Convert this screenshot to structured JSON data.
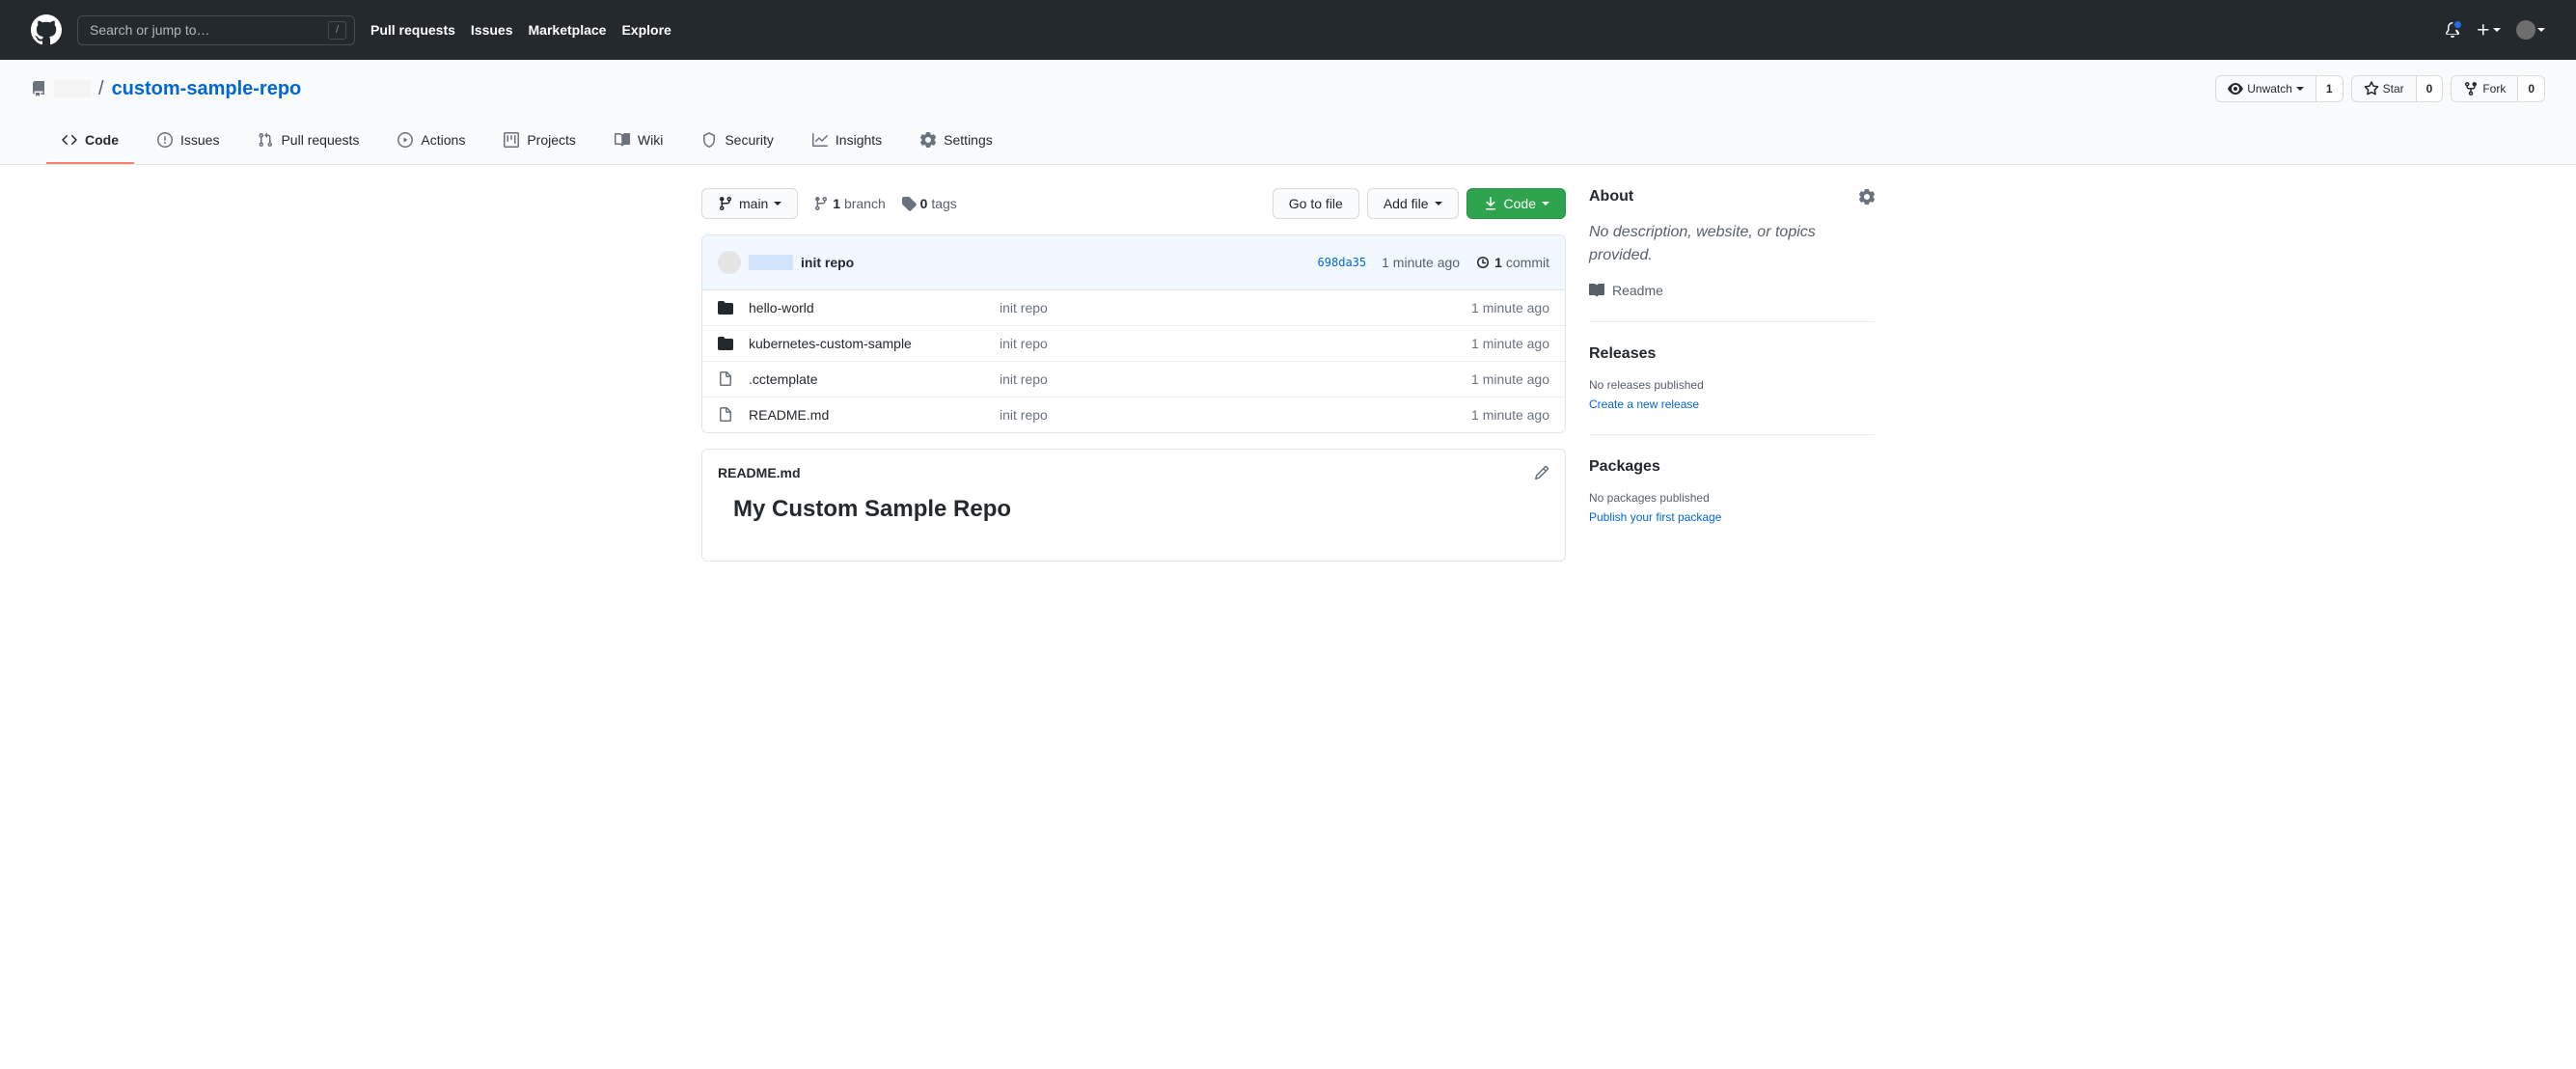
{
  "header": {
    "search_placeholder": "Search or jump to…",
    "slash": "/",
    "links": [
      "Pull requests",
      "Issues",
      "Marketplace",
      "Explore"
    ]
  },
  "repo": {
    "name": "custom-sample-repo",
    "divider": "/",
    "actions": {
      "watch": {
        "label": "Unwatch",
        "count": "1"
      },
      "star": {
        "label": "Star",
        "count": "0"
      },
      "fork": {
        "label": "Fork",
        "count": "0"
      }
    }
  },
  "nav": {
    "code": "Code",
    "issues": "Issues",
    "pulls": "Pull requests",
    "actions": "Actions",
    "projects": "Projects",
    "wiki": "Wiki",
    "security": "Security",
    "insights": "Insights",
    "settings": "Settings"
  },
  "filenav": {
    "branch": "main",
    "branches_count": "1",
    "branches_label": "branch",
    "tags_count": "0",
    "tags_label": "tags",
    "go_to_file": "Go to file",
    "add_file": "Add file",
    "code": "Code"
  },
  "commit": {
    "message": "init repo",
    "sha": "698da35",
    "time": "1 minute ago",
    "commits_count": "1",
    "commits_label": "commit"
  },
  "files": [
    {
      "type": "dir",
      "name": "hello-world",
      "msg": "init repo",
      "time": "1 minute ago"
    },
    {
      "type": "dir",
      "name": "kubernetes-custom-sample",
      "msg": "init repo",
      "time": "1 minute ago"
    },
    {
      "type": "file",
      "name": ".cctemplate",
      "msg": "init repo",
      "time": "1 minute ago"
    },
    {
      "type": "file",
      "name": "README.md",
      "msg": "init repo",
      "time": "1 minute ago"
    }
  ],
  "readme": {
    "filename": "README.md",
    "heading": "My Custom Sample Repo"
  },
  "sidebar": {
    "about": {
      "title": "About",
      "desc": "No description, website, or topics provided.",
      "readme": "Readme"
    },
    "releases": {
      "title": "Releases",
      "none": "No releases published",
      "create": "Create a new release"
    },
    "packages": {
      "title": "Packages",
      "none": "No packages published",
      "publish": "Publish your first package"
    }
  }
}
